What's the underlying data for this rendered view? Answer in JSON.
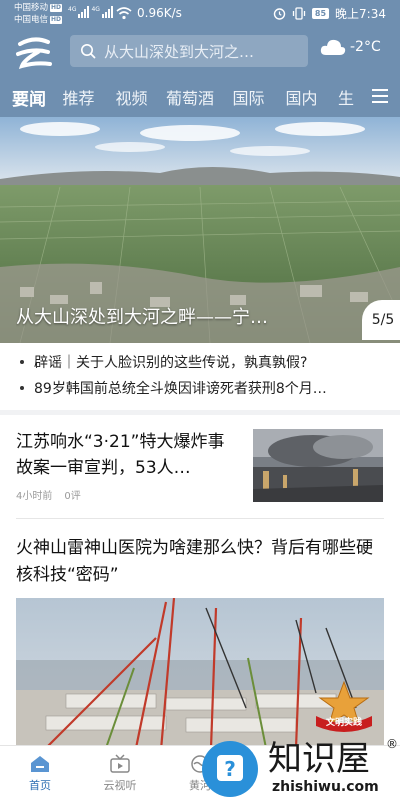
{
  "status_bar": {
    "carrier1": "中国移动",
    "carrier2": "中国电信",
    "hd_badge": "HD",
    "net1": "4G",
    "net2": "4G",
    "speed": "0.96K/s",
    "battery": "85",
    "time": "晚上7:34"
  },
  "header": {
    "search_placeholder": "从大山深处到大河之…",
    "weather_temp": "-2°C"
  },
  "tabs": [
    "要闻",
    "推荐",
    "视频",
    "葡萄酒",
    "国际",
    "国内",
    "生"
  ],
  "hero": {
    "caption": "从大山深处到大河之畔——宁…",
    "counter": "5/5"
  },
  "bullets": [
    "辟谣｜关于人脸识别的这些传说，孰真孰假?",
    "89岁韩国前总统全斗焕因诽谤死者获刑8个月…"
  ],
  "articles": [
    {
      "title": "江苏响水“3·21”特大爆炸事故案一审宣判，53人…",
      "time": "4小时前",
      "comments": "0评"
    },
    {
      "title": "火神山雷神山医院为啥建那么快？背后有哪些硬核科技“密码”",
      "badge": "文明实践"
    }
  ],
  "bottom_nav": [
    "首页",
    "云视听",
    "黄河"
  ],
  "watermark": {
    "text": "知识屋",
    "url": "zhishiwu.com",
    "registered": "®"
  },
  "colors": {
    "header_bg": "#6f8fb0",
    "active_nav": "#2e6fb3"
  }
}
